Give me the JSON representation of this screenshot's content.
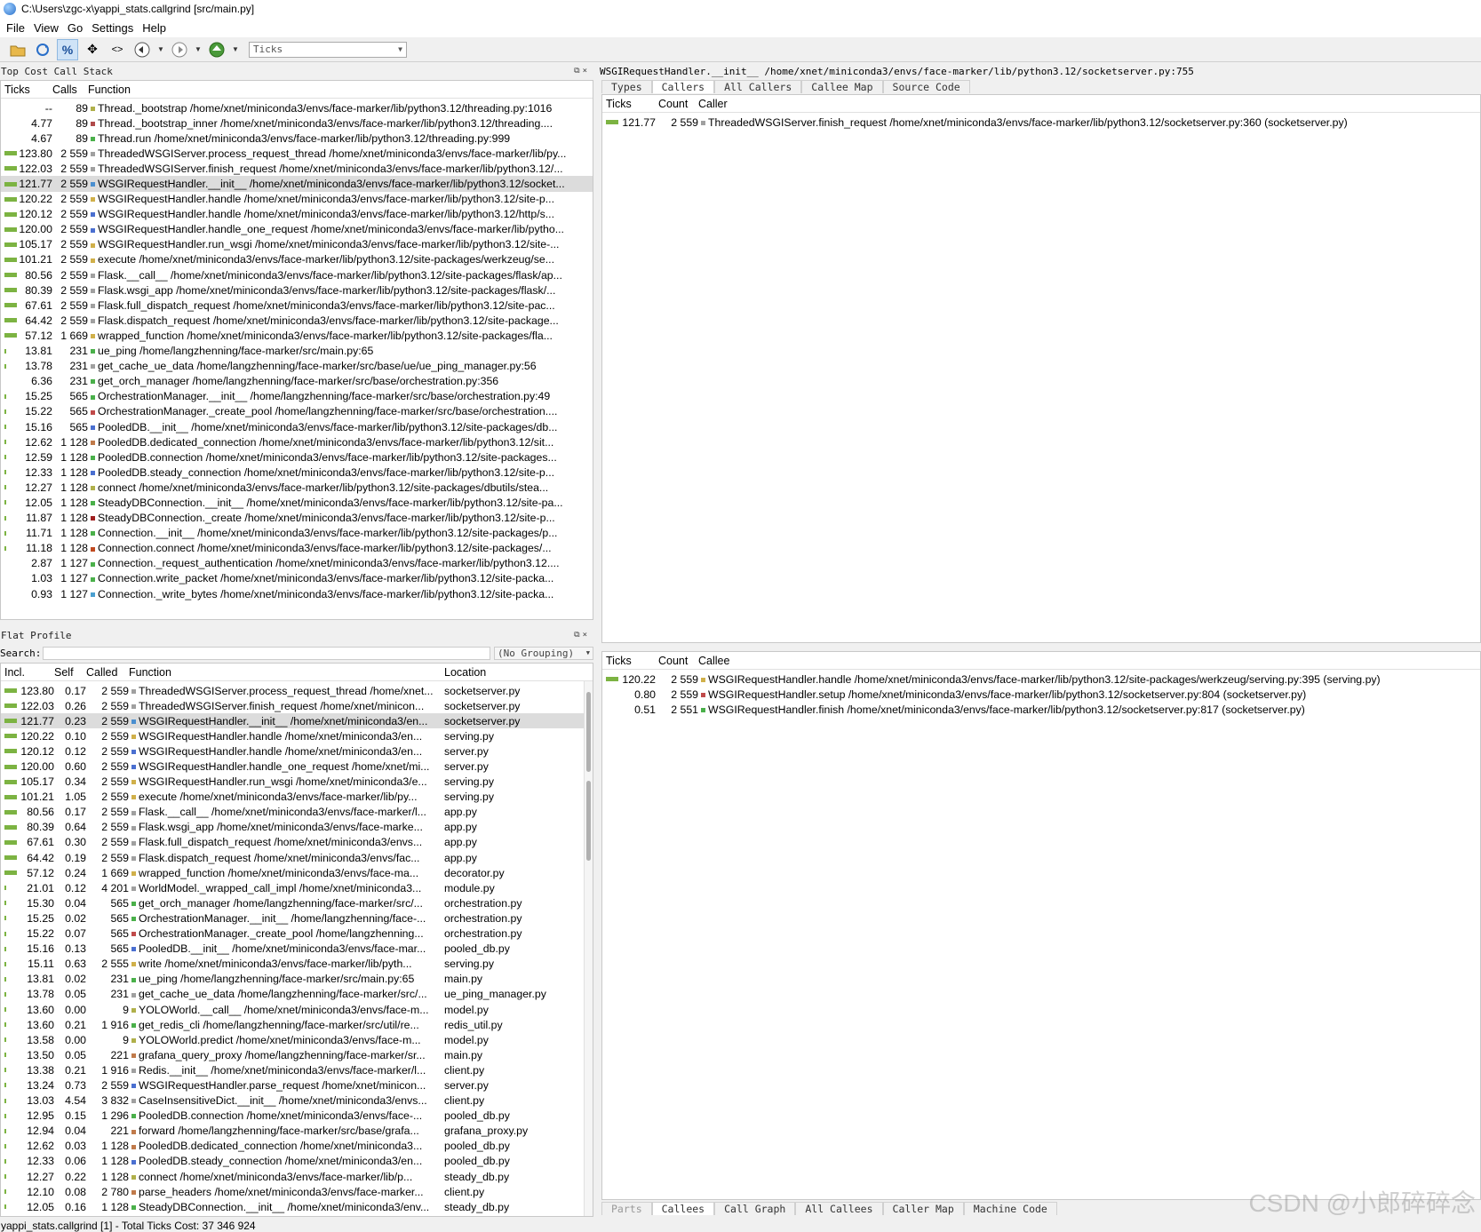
{
  "window": {
    "title": "C:\\Users\\zgc-x\\yappi_stats.callgrind [src/main.py]"
  },
  "menu": [
    "File",
    "View",
    "Go",
    "Settings",
    "Help"
  ],
  "toolbar": {
    "event_combo": "Ticks"
  },
  "top_cost": {
    "title": "Top Cost Call Stack",
    "headers": {
      "ticks": "Ticks",
      "calls": "Calls",
      "function": "Function"
    },
    "rows": [
      {
        "ticks": "--",
        "calls": "89",
        "func": "Thread._bootstrap /home/xnet/miniconda3/envs/face-marker/lib/python3.12/threading.py:1016",
        "bar": 0,
        "color": "#b0b04a"
      },
      {
        "ticks": "4.77",
        "calls": "89",
        "func": "Thread._bootstrap_inner /home/xnet/miniconda3/envs/face-marker/lib/python3.12/threading....",
        "bar": 0,
        "color": "#b04a4a"
      },
      {
        "ticks": "4.67",
        "calls": "89",
        "func": "Thread.run /home/xnet/miniconda3/envs/face-marker/lib/python3.12/threading.py:999",
        "bar": 0,
        "color": "#4ab04a"
      },
      {
        "ticks": "123.80",
        "calls": "2 559",
        "func": "ThreadedWSGIServer.process_request_thread /home/xnet/miniconda3/envs/face-marker/lib/py...",
        "bar": 1,
        "color": "#a0a0a0"
      },
      {
        "ticks": "122.03",
        "calls": "2 559",
        "func": "ThreadedWSGIServer.finish_request /home/xnet/miniconda3/envs/face-marker/lib/python3.12/...",
        "bar": 1,
        "color": "#a0a0a0"
      },
      {
        "ticks": "121.77",
        "calls": "2 559",
        "func": "WSGIRequestHandler.__init__ /home/xnet/miniconda3/envs/face-marker/lib/python3.12/socket...",
        "bar": 1,
        "color": "#4a8fd0",
        "sel": true
      },
      {
        "ticks": "120.22",
        "calls": "2 559",
        "func": "WSGIRequestHandler.handle /home/xnet/miniconda3/envs/face-marker/lib/python3.12/site-p...",
        "bar": 1,
        "color": "#d0b04a"
      },
      {
        "ticks": "120.12",
        "calls": "2 559",
        "func": "WSGIRequestHandler.handle /home/xnet/miniconda3/envs/face-marker/lib/python3.12/http/s...",
        "bar": 1,
        "color": "#4a6fd0"
      },
      {
        "ticks": "120.00",
        "calls": "2 559",
        "func": "WSGIRequestHandler.handle_one_request /home/xnet/miniconda3/envs/face-marker/lib/pytho...",
        "bar": 1,
        "color": "#4a6fd0"
      },
      {
        "ticks": "105.17",
        "calls": "2 559",
        "func": "WSGIRequestHandler.run_wsgi /home/xnet/miniconda3/envs/face-marker/lib/python3.12/site-...",
        "bar": 1,
        "color": "#d0b04a"
      },
      {
        "ticks": "101.21",
        "calls": "2 559",
        "func": "execute /home/xnet/miniconda3/envs/face-marker/lib/python3.12/site-packages/werkzeug/se...",
        "bar": 1,
        "color": "#d0b04a"
      },
      {
        "ticks": "80.56",
        "calls": "2 559",
        "func": "Flask.__call__ /home/xnet/miniconda3/envs/face-marker/lib/python3.12/site-packages/flask/ap...",
        "bar": 1,
        "color": "#a0a0a0"
      },
      {
        "ticks": "80.39",
        "calls": "2 559",
        "func": "Flask.wsgi_app /home/xnet/miniconda3/envs/face-marker/lib/python3.12/site-packages/flask/...",
        "bar": 1,
        "color": "#a0a0a0"
      },
      {
        "ticks": "67.61",
        "calls": "2 559",
        "func": "Flask.full_dispatch_request /home/xnet/miniconda3/envs/face-marker/lib/python3.12/site-pac...",
        "bar": 1,
        "color": "#a0a0a0"
      },
      {
        "ticks": "64.42",
        "calls": "2 559",
        "func": "Flask.dispatch_request /home/xnet/miniconda3/envs/face-marker/lib/python3.12/site-package...",
        "bar": 1,
        "color": "#a0a0a0"
      },
      {
        "ticks": "57.12",
        "calls": "1 669",
        "func": "wrapped_function /home/xnet/miniconda3/envs/face-marker/lib/python3.12/site-packages/fla...",
        "bar": 1,
        "color": "#d0b04a"
      },
      {
        "ticks": "13.81",
        "calls": "231",
        "func": "ue_ping /home/langzhenning/face-marker/src/main.py:65",
        "bar": 0.2,
        "color": "#4ab04a"
      },
      {
        "ticks": "13.78",
        "calls": "231",
        "func": "get_cache_ue_data /home/langzhenning/face-marker/src/base/ue/ue_ping_manager.py:56",
        "bar": 0.2,
        "color": "#a0a0a0"
      },
      {
        "ticks": "6.36",
        "calls": "231",
        "func": "get_orch_manager /home/langzhenning/face-marker/src/base/orchestration.py:356",
        "bar": 0,
        "color": "#4ab04a"
      },
      {
        "ticks": "15.25",
        "calls": "565",
        "func": "OrchestrationManager.__init__ /home/langzhenning/face-marker/src/base/orchestration.py:49",
        "bar": 0.2,
        "color": "#4ab04a"
      },
      {
        "ticks": "15.22",
        "calls": "565",
        "func": "OrchestrationManager._create_pool /home/langzhenning/face-marker/src/base/orchestration....",
        "bar": 0.2,
        "color": "#c04a4a"
      },
      {
        "ticks": "15.16",
        "calls": "565",
        "func": "PooledDB.__init__ /home/xnet/miniconda3/envs/face-marker/lib/python3.12/site-packages/db...",
        "bar": 0.2,
        "color": "#4a6fd0"
      },
      {
        "ticks": "12.62",
        "calls": "1 128",
        "func": "PooledDB.dedicated_connection /home/xnet/miniconda3/envs/face-marker/lib/python3.12/sit...",
        "bar": 0.2,
        "color": "#c07a4a"
      },
      {
        "ticks": "12.59",
        "calls": "1 128",
        "func": "PooledDB.connection /home/xnet/miniconda3/envs/face-marker/lib/python3.12/site-packages...",
        "bar": 0.2,
        "color": "#4ab04a"
      },
      {
        "ticks": "12.33",
        "calls": "1 128",
        "func": "PooledDB.steady_connection /home/xnet/miniconda3/envs/face-marker/lib/python3.12/site-p...",
        "bar": 0.2,
        "color": "#4a6fd0"
      },
      {
        "ticks": "12.27",
        "calls": "1 128",
        "func": "connect /home/xnet/miniconda3/envs/face-marker/lib/python3.12/site-packages/dbutils/stea...",
        "bar": 0.2,
        "color": "#b0b04a"
      },
      {
        "ticks": "12.05",
        "calls": "1 128",
        "func": "SteadyDBConnection.__init__ /home/xnet/miniconda3/envs/face-marker/lib/python3.12/site-pa...",
        "bar": 0.2,
        "color": "#4ab04a"
      },
      {
        "ticks": "11.87",
        "calls": "1 128",
        "func": "SteadyDBConnection._create /home/xnet/miniconda3/envs/face-marker/lib/python3.12/site-p...",
        "bar": 0.2,
        "color": "#a02020"
      },
      {
        "ticks": "11.71",
        "calls": "1 128",
        "func": "Connection.__init__ /home/xnet/miniconda3/envs/face-marker/lib/python3.12/site-packages/p...",
        "bar": 0.2,
        "color": "#4ab04a"
      },
      {
        "ticks": "11.18",
        "calls": "1 128",
        "func": "Connection.connect /home/xnet/miniconda3/envs/face-marker/lib/python3.12/site-packages/...",
        "bar": 0.2,
        "color": "#c04a20"
      },
      {
        "ticks": "2.87",
        "calls": "1 127",
        "func": "Connection._request_authentication /home/xnet/miniconda3/envs/face-marker/lib/python3.12....",
        "bar": 0,
        "color": "#4ab04a"
      },
      {
        "ticks": "1.03",
        "calls": "1 127",
        "func": "Connection.write_packet /home/xnet/miniconda3/envs/face-marker/lib/python3.12/site-packa...",
        "bar": 0,
        "color": "#4ab04a"
      },
      {
        "ticks": "0.93",
        "calls": "1 127",
        "func": "Connection._write_bytes /home/xnet/miniconda3/envs/face-marker/lib/python3.12/site-packa...",
        "bar": 0,
        "color": "#4a9fd0"
      }
    ]
  },
  "flat": {
    "title": "Flat Profile",
    "search_label": "Search:",
    "grouping": "(No Grouping)",
    "headers": {
      "incl": "Incl.",
      "self": "Self",
      "called": "Called",
      "function": "Function",
      "location": "Location"
    },
    "rows": [
      {
        "incl": "123.80",
        "self": "0.17",
        "called": "2 559",
        "func": "ThreadedWSGIServer.process_request_thread /home/xnet...",
        "loc": "socketserver.py",
        "bar": 1,
        "color": "#a0a0a0"
      },
      {
        "incl": "122.03",
        "self": "0.26",
        "called": "2 559",
        "func": "ThreadedWSGIServer.finish_request /home/xnet/minicon...",
        "loc": "socketserver.py",
        "bar": 1,
        "color": "#a0a0a0"
      },
      {
        "incl": "121.77",
        "self": "0.23",
        "called": "2 559",
        "func": "WSGIRequestHandler.__init__ /home/xnet/miniconda3/en...",
        "loc": "socketserver.py",
        "bar": 1,
        "color": "#4a8fd0",
        "sel": true
      },
      {
        "incl": "120.22",
        "self": "0.10",
        "called": "2 559",
        "func": "WSGIRequestHandler.handle /home/xnet/miniconda3/en...",
        "loc": "serving.py",
        "bar": 1,
        "color": "#d0b04a"
      },
      {
        "incl": "120.12",
        "self": "0.12",
        "called": "2 559",
        "func": "WSGIRequestHandler.handle /home/xnet/miniconda3/en...",
        "loc": "server.py",
        "bar": 1,
        "color": "#4a6fd0"
      },
      {
        "incl": "120.00",
        "self": "0.60",
        "called": "2 559",
        "func": "WSGIRequestHandler.handle_one_request /home/xnet/mi...",
        "loc": "server.py",
        "bar": 1,
        "color": "#4a6fd0"
      },
      {
        "incl": "105.17",
        "self": "0.34",
        "called": "2 559",
        "func": "WSGIRequestHandler.run_wsgi /home/xnet/miniconda3/e...",
        "loc": "serving.py",
        "bar": 1,
        "color": "#d0b04a"
      },
      {
        "incl": "101.21",
        "self": "1.05",
        "called": "2 559",
        "func": "execute /home/xnet/miniconda3/envs/face-marker/lib/py...",
        "loc": "serving.py",
        "bar": 1,
        "color": "#d0b04a"
      },
      {
        "incl": "80.56",
        "self": "0.17",
        "called": "2 559",
        "func": "Flask.__call__ /home/xnet/miniconda3/envs/face-marker/l...",
        "loc": "app.py",
        "bar": 1,
        "color": "#a0a0a0"
      },
      {
        "incl": "80.39",
        "self": "0.64",
        "called": "2 559",
        "func": "Flask.wsgi_app /home/xnet/miniconda3/envs/face-marke...",
        "loc": "app.py",
        "bar": 1,
        "color": "#a0a0a0"
      },
      {
        "incl": "67.61",
        "self": "0.30",
        "called": "2 559",
        "func": "Flask.full_dispatch_request /home/xnet/miniconda3/envs...",
        "loc": "app.py",
        "bar": 1,
        "color": "#a0a0a0"
      },
      {
        "incl": "64.42",
        "self": "0.19",
        "called": "2 559",
        "func": "Flask.dispatch_request /home/xnet/miniconda3/envs/fac...",
        "loc": "app.py",
        "bar": 1,
        "color": "#a0a0a0"
      },
      {
        "incl": "57.12",
        "self": "0.24",
        "called": "1 669",
        "func": "wrapped_function /home/xnet/miniconda3/envs/face-ma...",
        "loc": "decorator.py",
        "bar": 1,
        "color": "#d0b04a"
      },
      {
        "incl": "21.01",
        "self": "0.12",
        "called": "4 201",
        "func": "WorldModel._wrapped_call_impl /home/xnet/miniconda3...",
        "loc": "module.py",
        "bar": 0.2,
        "color": "#a0a0a0"
      },
      {
        "incl": "15.30",
        "self": "0.04",
        "called": "565",
        "func": "get_orch_manager /home/langzhenning/face-marker/src/...",
        "loc": "orchestration.py",
        "bar": 0.2,
        "color": "#4ab04a"
      },
      {
        "incl": "15.25",
        "self": "0.02",
        "called": "565",
        "func": "OrchestrationManager.__init__ /home/langzhenning/face-...",
        "loc": "orchestration.py",
        "bar": 0.2,
        "color": "#4ab04a"
      },
      {
        "incl": "15.22",
        "self": "0.07",
        "called": "565",
        "func": "OrchestrationManager._create_pool /home/langzhenning...",
        "loc": "orchestration.py",
        "bar": 0.2,
        "color": "#c04a4a"
      },
      {
        "incl": "15.16",
        "self": "0.13",
        "called": "565",
        "func": "PooledDB.__init__ /home/xnet/miniconda3/envs/face-mar...",
        "loc": "pooled_db.py",
        "bar": 0.2,
        "color": "#4a6fd0"
      },
      {
        "incl": "15.11",
        "self": "0.63",
        "called": "2 555",
        "func": "write /home/xnet/miniconda3/envs/face-marker/lib/pyth...",
        "loc": "serving.py",
        "bar": 0.2,
        "color": "#d0b04a"
      },
      {
        "incl": "13.81",
        "self": "0.02",
        "called": "231",
        "func": "ue_ping /home/langzhenning/face-marker/src/main.py:65",
        "loc": "main.py",
        "bar": 0.2,
        "color": "#4ab04a"
      },
      {
        "incl": "13.78",
        "self": "0.05",
        "called": "231",
        "func": "get_cache_ue_data /home/langzhenning/face-marker/src/...",
        "loc": "ue_ping_manager.py",
        "bar": 0.2,
        "color": "#a0a0a0"
      },
      {
        "incl": "13.60",
        "self": "0.00",
        "called": "9",
        "func": "YOLOWorld.__call__ /home/xnet/miniconda3/envs/face-m...",
        "loc": "model.py",
        "bar": 0.2,
        "color": "#b0b04a"
      },
      {
        "incl": "13.60",
        "self": "0.21",
        "called": "1 916",
        "func": "get_redis_cli /home/langzhenning/face-marker/src/util/re...",
        "loc": "redis_util.py",
        "bar": 0.2,
        "color": "#4ab04a"
      },
      {
        "incl": "13.58",
        "self": "0.00",
        "called": "9",
        "func": "YOLOWorld.predict /home/xnet/miniconda3/envs/face-m...",
        "loc": "model.py",
        "bar": 0.2,
        "color": "#b0b04a"
      },
      {
        "incl": "13.50",
        "self": "0.05",
        "called": "221",
        "func": "grafana_query_proxy /home/langzhenning/face-marker/sr...",
        "loc": "main.py",
        "bar": 0.2,
        "color": "#c07a4a"
      },
      {
        "incl": "13.38",
        "self": "0.21",
        "called": "1 916",
        "func": "Redis.__init__ /home/xnet/miniconda3/envs/face-marker/l...",
        "loc": "client.py",
        "bar": 0.2,
        "color": "#a0a0a0"
      },
      {
        "incl": "13.24",
        "self": "0.73",
        "called": "2 559",
        "func": "WSGIRequestHandler.parse_request /home/xnet/minicon...",
        "loc": "server.py",
        "bar": 0.2,
        "color": "#4a6fd0"
      },
      {
        "incl": "13.03",
        "self": "4.54",
        "called": "3 832",
        "func": "CaseInsensitiveDict.__init__ /home/xnet/miniconda3/envs...",
        "loc": "client.py",
        "bar": 0.2,
        "color": "#a0a0a0"
      },
      {
        "incl": "12.95",
        "self": "0.15",
        "called": "1 296",
        "func": "PooledDB.connection /home/xnet/miniconda3/envs/face-...",
        "loc": "pooled_db.py",
        "bar": 0.2,
        "color": "#4ab04a"
      },
      {
        "incl": "12.94",
        "self": "0.04",
        "called": "221",
        "func": "forward /home/langzhenning/face-marker/src/base/grafa...",
        "loc": "grafana_proxy.py",
        "bar": 0.2,
        "color": "#c07a4a"
      },
      {
        "incl": "12.62",
        "self": "0.03",
        "called": "1 128",
        "func": "PooledDB.dedicated_connection /home/xnet/miniconda3...",
        "loc": "pooled_db.py",
        "bar": 0.2,
        "color": "#c07a4a"
      },
      {
        "incl": "12.33",
        "self": "0.06",
        "called": "1 128",
        "func": "PooledDB.steady_connection /home/xnet/miniconda3/en...",
        "loc": "pooled_db.py",
        "bar": 0.2,
        "color": "#4a6fd0"
      },
      {
        "incl": "12.27",
        "self": "0.22",
        "called": "1 128",
        "func": "connect /home/xnet/miniconda3/envs/face-marker/lib/p...",
        "loc": "steady_db.py",
        "bar": 0.2,
        "color": "#b0b04a"
      },
      {
        "incl": "12.10",
        "self": "0.08",
        "called": "2 780",
        "func": "parse_headers /home/xnet/miniconda3/envs/face-marker...",
        "loc": "client.py",
        "bar": 0.2,
        "color": "#c07a4a"
      },
      {
        "incl": "12.05",
        "self": "0.16",
        "called": "1 128",
        "func": "SteadyDBConnection.__init__ /home/xnet/miniconda3/env...",
        "loc": "steady_db.py",
        "bar": 0.2,
        "color": "#4ab04a"
      }
    ]
  },
  "right_top": {
    "header_path": "WSGIRequestHandler.__init__ /home/xnet/miniconda3/envs/face-marker/lib/python3.12/socketserver.py:755",
    "tabs": [
      {
        "label": "Types",
        "state": "normal"
      },
      {
        "label": "Callers",
        "state": "active"
      },
      {
        "label": "All Callers",
        "state": "normal"
      },
      {
        "label": "Callee Map",
        "state": "normal"
      },
      {
        "label": "Source Code",
        "state": "normal"
      }
    ],
    "headers": {
      "ticks": "Ticks",
      "count": "Count",
      "caller": "Caller"
    },
    "rows": [
      {
        "ticks": "121.77",
        "count": "2 559",
        "name": "ThreadedWSGIServer.finish_request /home/xnet/miniconda3/envs/face-marker/lib/python3.12/socketserver.py:360 (socketserver.py)",
        "bar": 1,
        "color": "#a0a0a0"
      }
    ]
  },
  "right_bottom": {
    "headers": {
      "ticks": "Ticks",
      "count": "Count",
      "callee": "Callee"
    },
    "rows": [
      {
        "ticks": "120.22",
        "count": "2 559",
        "name": "WSGIRequestHandler.handle /home/xnet/miniconda3/envs/face-marker/lib/python3.12/site-packages/werkzeug/serving.py:395 (serving.py)",
        "bar": 1,
        "color": "#d0b04a"
      },
      {
        "ticks": "0.80",
        "count": "2 559",
        "name": "WSGIRequestHandler.setup /home/xnet/miniconda3/envs/face-marker/lib/python3.12/socketserver.py:804 (socketserver.py)",
        "bar": 0,
        "color": "#c04a4a"
      },
      {
        "ticks": "0.51",
        "count": "2 551",
        "name": "WSGIRequestHandler.finish /home/xnet/miniconda3/envs/face-marker/lib/python3.12/socketserver.py:817 (socketserver.py)",
        "bar": 0,
        "color": "#4ab04a"
      }
    ],
    "tabs": [
      {
        "label": "Parts",
        "state": "disabled"
      },
      {
        "label": "Callees",
        "state": "active"
      },
      {
        "label": "Call Graph",
        "state": "normal"
      },
      {
        "label": "All Callees",
        "state": "normal"
      },
      {
        "label": "Caller Map",
        "state": "normal"
      },
      {
        "label": "Machine Code",
        "state": "normal"
      }
    ]
  },
  "status": {
    "text": "yappi_stats.callgrind [1] - Total Ticks Cost: 37 346 924"
  },
  "watermark": "CSDN @小郎碎碎念"
}
